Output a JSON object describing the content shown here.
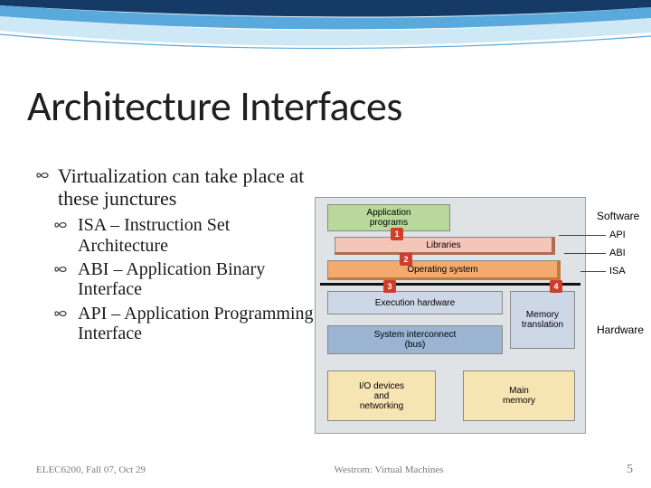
{
  "title": "Architecture Interfaces",
  "bullets": {
    "main": "Virtualization can take place at these junctures",
    "sub": [
      "ISA – Instruction Set Architecture",
      "ABI – Application Binary Interface",
      "API – Application Programming Interface"
    ]
  },
  "diagram": {
    "software_label": "Software",
    "hardware_label": "Hardware",
    "api_label": "API",
    "abi_label": "ABI",
    "isa_label": "ISA",
    "app_prog": "Application\nprograms",
    "libraries": "Libraries",
    "os": "Operating system",
    "exec_hw": "Execution hardware",
    "sys_bus": "System interconnect\n(bus)",
    "mem_trans": "Memory\ntranslation",
    "io_dev": "I/O devices\nand\nnetworking",
    "main_mem": "Main\nmemory",
    "num1": "1",
    "num2": "2",
    "num3": "3",
    "num4": "4"
  },
  "footer": {
    "left": "ELEC6200, Fall 07, Oct 29",
    "center": "Westrom: Virtual Machines",
    "page": "5"
  }
}
